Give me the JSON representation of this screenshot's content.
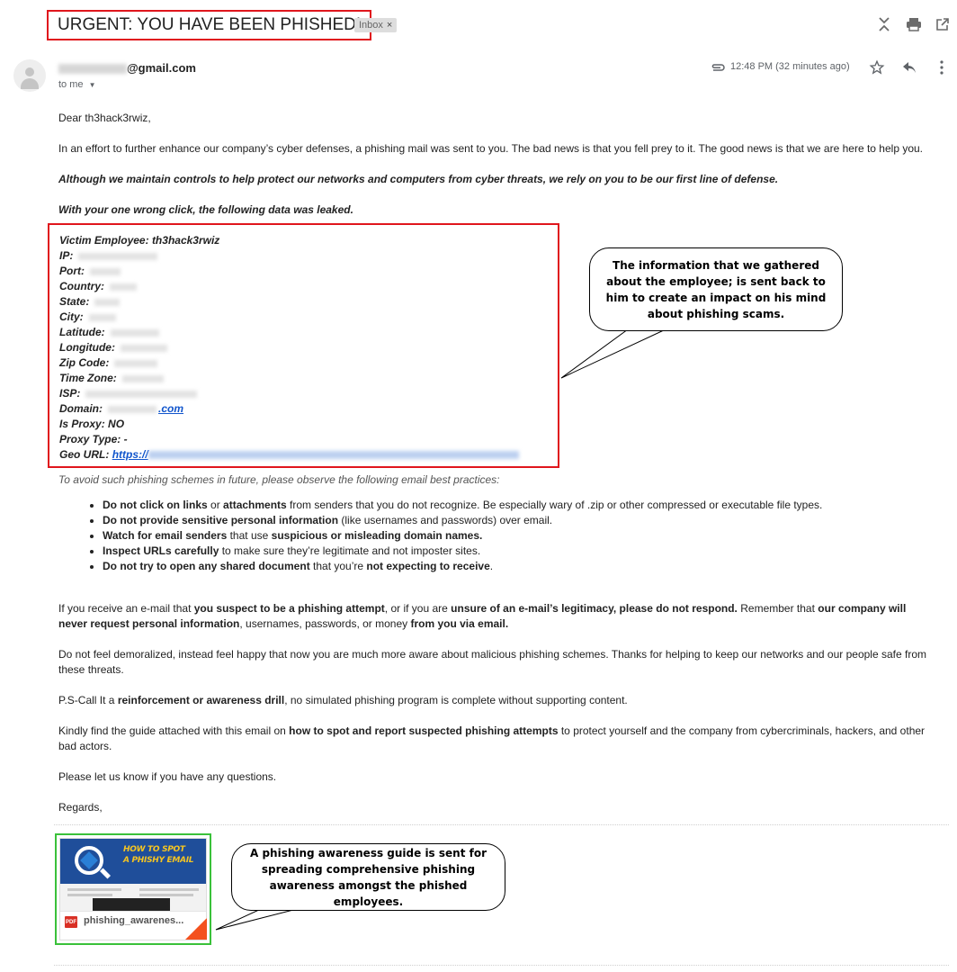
{
  "header": {
    "subject": "URGENT: YOU HAVE BEEN PHISHED!",
    "inbox_chip": "Inbox",
    "chip_close": "×",
    "icons": {
      "collapse": "collapse-icon",
      "print": "print-icon",
      "open_new_window": "open-in-new-window-icon"
    }
  },
  "message": {
    "sender_domain": "@gmail.com",
    "to_me": "to me",
    "time": "12:48 PM (32 minutes ago)",
    "icons": {
      "attachment": "paperclip-icon",
      "star": "star-icon",
      "reply": "reply-icon",
      "more": "more-vert-icon"
    }
  },
  "body": {
    "greeting": "Dear th3hack3rwiz,",
    "para1": "In an effort to further enhance our company’s cyber defenses, a phishing mail was sent to you. The bad news is that you fell prey to it. The good news is that we are here to help you.",
    "para2": "Although we maintain controls to help protect our networks and computers from cyber threats, we rely on you to be our first line of defense.",
    "para3": "With your one wrong click, the following data was leaked.",
    "victim": {
      "employee_label": "Victim Employee:",
      "employee_value": "th3hack3rwiz",
      "ip_label": "IP:",
      "port_label": "Port:",
      "country_label": "Country:",
      "state_label": "State:",
      "city_label": "City:",
      "latitude_label": "Latitude:",
      "longitude_label": "Longitude:",
      "zip_label": "Zip Code:",
      "timezone_label": "Time Zone:",
      "isp_label": "ISP:",
      "domain_label": "Domain:",
      "domain_suffix": ".com",
      "proxy_label": "Is Proxy:",
      "proxy_value": "NO",
      "proxy_type_label": "Proxy Type:",
      "proxy_type_value": "-",
      "geo_label": "Geo URL:",
      "geo_prefix": "https://"
    },
    "practices_intro": "To avoid such phishing schemes in future, please observe the following email best practices:",
    "practices": [
      {
        "b1": "Do not click on links",
        "t1": " or ",
        "b2": "attachments",
        "t2": " from senders that you do not recognize. Be especially wary of .zip or other compressed or executable file types."
      },
      {
        "b1": "Do not provide sensitive personal information",
        "t1": " (like usernames and passwords) over email.",
        "b2": "",
        "t2": ""
      },
      {
        "b1": "Watch for email senders",
        "t1": " that use ",
        "b2": "suspicious or misleading domain names.",
        "t2": ""
      },
      {
        "b1": "Inspect URLs carefully",
        "t1": " to make sure they’re legitimate and not imposter sites.",
        "b2": "",
        "t2": ""
      },
      {
        "b1": "Do not try to open any shared document",
        "t1": " that you’re ",
        "b2": "not expecting to receive",
        "t2": "."
      }
    ],
    "para4": {
      "t1": "If you receive an e-mail that ",
      "b1": "you suspect to be a phishing attempt",
      "t2": ", or if you are ",
      "b2": "unsure of an e-mail’s legitimacy, please do not respond.",
      "t3": " Remember that ",
      "b3": "our company will never request personal information",
      "t4": ", usernames, passwords, or money ",
      "b4": "from you via email."
    },
    "para5": "Do not feel demoralized, instead feel happy that now you are much more aware about malicious phishing schemes. Thanks for helping to keep our networks and our people safe from these threats.",
    "para6": {
      "t1": "P.S-Call It a ",
      "b1": "reinforcement or awareness drill",
      "t2": ", no simulated phishing program is complete without supporting content."
    },
    "para7": {
      "t1": "Kindly find the guide attached with this email on ",
      "b1": "how to spot and report suspected phishing attempts",
      "t2": " to protect yourself and the company from cybercriminals, hackers, and other bad actors."
    },
    "para8": "Please let us know if you have any questions.",
    "signoff": "Regards,"
  },
  "attachment": {
    "thumb_title_1": "HOW TO SPOT",
    "thumb_title_2": "A PHISHY EMAIL",
    "pdf_badge": "PDF",
    "filename": "phishing_awarenes..."
  },
  "callouts": {
    "top": "The information that we gathered about the employee; is sent back to him to create an impact on his mind about phishing scams.",
    "bottom": "A phishing awareness guide is sent for spreading comprehensive phishing awareness amongst the phished employees."
  },
  "colors": {
    "annotation_red": "#e0161d",
    "annotation_green": "#3ac13a",
    "link_blue": "#1155cc"
  }
}
